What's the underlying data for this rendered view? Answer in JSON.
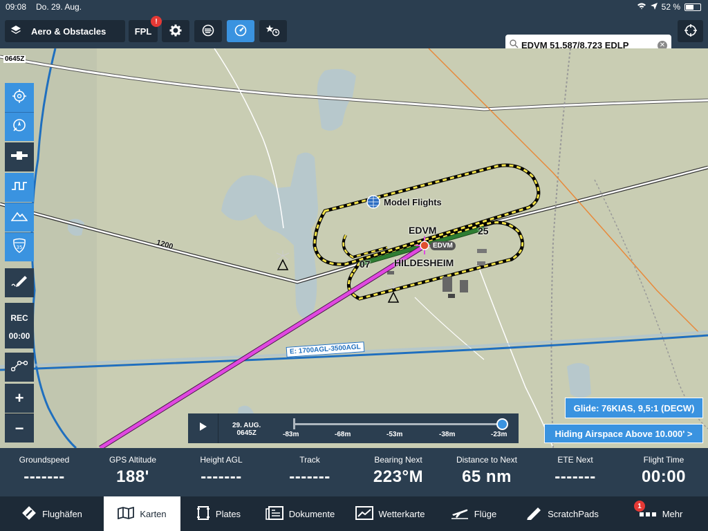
{
  "status_bar": {
    "time": "09:08",
    "date": "Do. 29. Aug.",
    "battery": "52 %"
  },
  "toolbar": {
    "layers_label": "Aero & Obstacles",
    "fpl_label": "FPL",
    "fpl_badge": "!",
    "search_value": "EDVM 51,587/8,723 EDLP"
  },
  "map": {
    "timestamp": "0645Z",
    "airport_code": "EDVM",
    "airport_name": "HILDESHEIM",
    "airport_tag": "EDVM",
    "runway_east": "25",
    "runway_west": "07",
    "poi_label": "Model Flights",
    "route_altitude": "1200",
    "airspace_label": "E: 1700AGL-3500AGL"
  },
  "left_tools": {
    "rec_label": "REC",
    "rec_time": "00:00",
    "zoom_in": "+",
    "zoom_out": "−"
  },
  "timeline": {
    "date": "29. AUG.",
    "time": "0645Z",
    "ticks": [
      "-83m",
      "-68m",
      "-53m",
      "-38m",
      "-23m"
    ]
  },
  "glide_label": "Glide: 76KIAS, 9,5:1 (DECW)",
  "airspace_filter_label": "Hiding Airspace Above 10.000' >",
  "instruments": [
    {
      "label": "Groundspeed",
      "value": "-------"
    },
    {
      "label": "GPS Altitude",
      "value": "188'"
    },
    {
      "label": "Height AGL",
      "value": "-------"
    },
    {
      "label": "Track",
      "value": "-------"
    },
    {
      "label": "Bearing Next",
      "value": "223°M"
    },
    {
      "label": "Distance to Next",
      "value": "65 nm"
    },
    {
      "label": "ETE Next",
      "value": "-------"
    },
    {
      "label": "Flight Time",
      "value": "00:00"
    }
  ],
  "tabs": [
    {
      "label": "Flughäfen",
      "icon": "airport-icon"
    },
    {
      "label": "Karten",
      "icon": "map-icon"
    },
    {
      "label": "Plates",
      "icon": "plates-icon"
    },
    {
      "label": "Dokumente",
      "icon": "documents-icon"
    },
    {
      "label": "Wetterkarte",
      "icon": "weather-chart-icon"
    },
    {
      "label": "Flüge",
      "icon": "flights-icon"
    },
    {
      "label": "ScratchPads",
      "icon": "scratchpad-icon"
    },
    {
      "label": "Mehr",
      "icon": "more-icon",
      "badge": "1"
    }
  ],
  "colors": {
    "accent": "#3a93e0",
    "panel": "#2b3e50",
    "route": "#e048e0",
    "terrain": "#c9cdb3"
  }
}
